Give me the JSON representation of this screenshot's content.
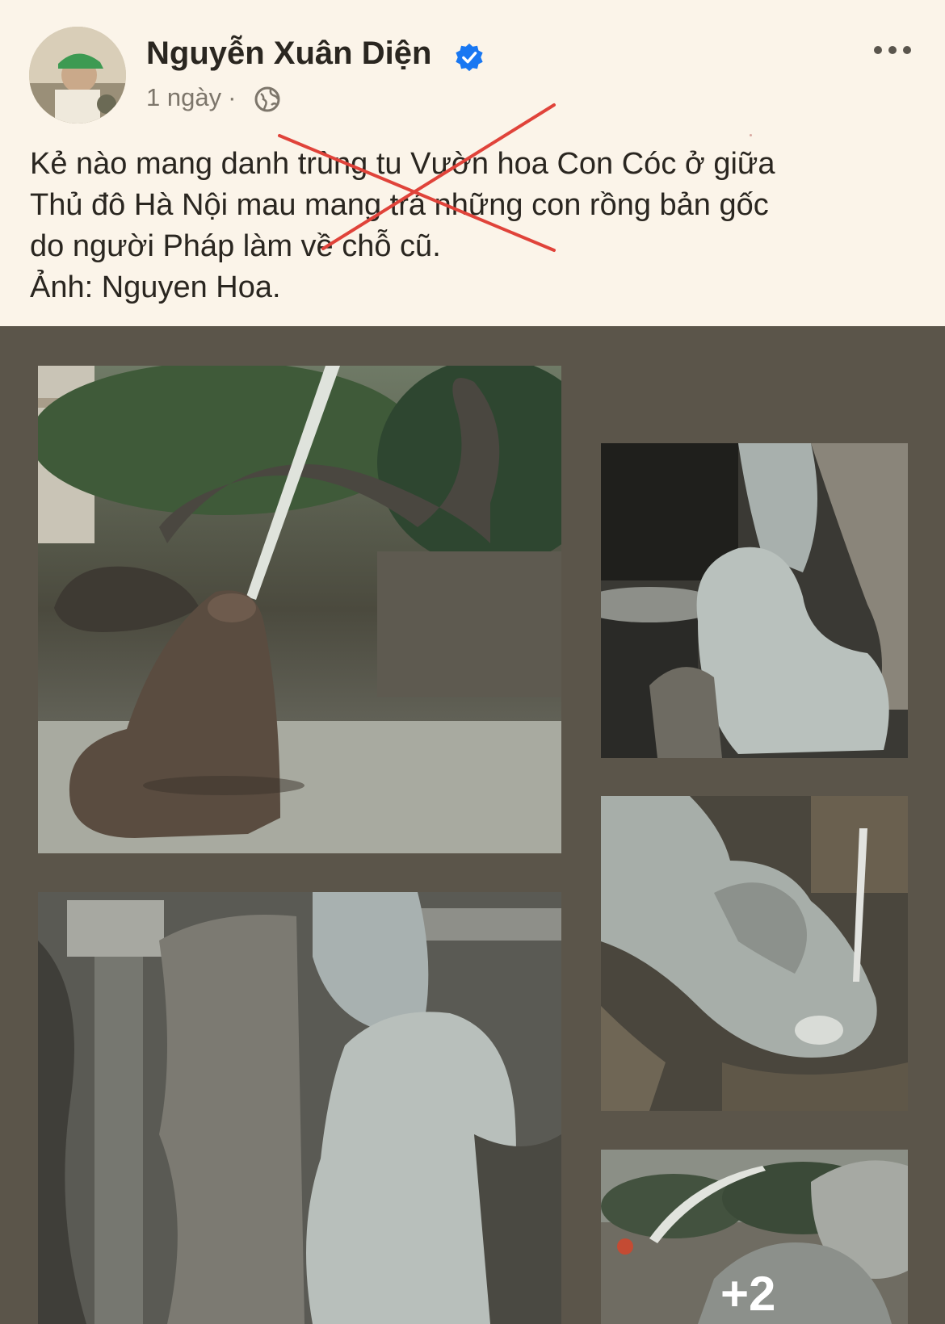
{
  "post": {
    "author": "Nguyễn Xuân Diện",
    "verified_icon": "verified-badge-icon",
    "time": "1 ngày",
    "separator": "·",
    "privacy_icon": "globe-icon",
    "more_icon": "more-options-icon",
    "text_lines": [
      "Kẻ nào mang danh trùng tu Vườn hoa Con Cóc ở giữa",
      "Thủ đô Hà Nội mau mang trả những con rồng bản gốc",
      "do người Pháp làm về chỗ cũ."
    ],
    "credit": "Ảnh: Nguyen Hoa."
  },
  "gallery": {
    "more_count": "+2"
  },
  "colors": {
    "background": "#fbf4e9",
    "gallery_background": "#5b554a",
    "verified": "#1877f2",
    "cross": "#e0433a"
  }
}
